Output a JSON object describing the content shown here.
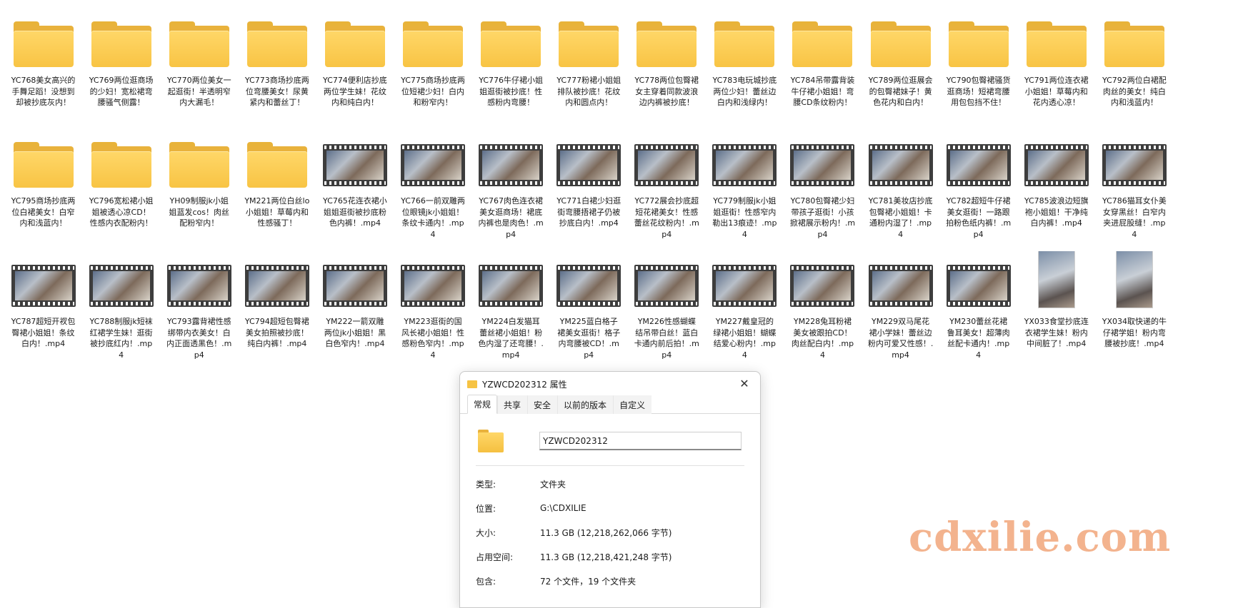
{
  "items": [
    {
      "kind": "folder",
      "label": "YC768美女高兴的手舞足蹈！没想到却被抄底灰内！"
    },
    {
      "kind": "folder",
      "label": "YC769两位逛商场的少妇！宽松裙弯腰骚气侧露！"
    },
    {
      "kind": "folder",
      "label": "YC770两位美女一起逛街！半透明窄内大漏毛！"
    },
    {
      "kind": "folder",
      "label": "YC773商场抄底两位弯腰美女！尿黄紧内和蕾丝丁！"
    },
    {
      "kind": "folder",
      "label": "YC774便利店抄底两位学生妹！花纹内和纯白内！"
    },
    {
      "kind": "folder",
      "label": "YC775商场抄底两位短裙少妇！白内和粉窄内！"
    },
    {
      "kind": "folder",
      "label": "YC776牛仔裙小姐姐逛街被抄底！性感粉内弯腰！"
    },
    {
      "kind": "folder",
      "label": "YC777粉裙小姐姐排队被抄底！花纹内和圆点内！"
    },
    {
      "kind": "folder",
      "label": "YC778两位包臀裙女主穿着同款波浪边内裤被抄底！"
    },
    {
      "kind": "folder",
      "label": "YC783电玩城抄底两位少妇！蕾丝边白内和浅绿内！"
    },
    {
      "kind": "folder",
      "label": "YC784吊带露背装牛仔裙小姐姐！弯腰CD条纹粉内！"
    },
    {
      "kind": "folder",
      "label": "YC789两位逛展会的包臀裙妹子！黄色花内和白内！"
    },
    {
      "kind": "folder",
      "label": "YC790包臀裙骚货逛商场！短裙弯腰用包包挡不住！"
    },
    {
      "kind": "folder",
      "label": "YC791两位连衣裙小姐姐！草莓内和花内透心凉！"
    },
    {
      "kind": "folder",
      "label": "YC792两位白裙配肉丝的美女！纯白内和浅蓝内！"
    },
    {
      "kind": "folder",
      "label": "YC795商场抄底两位白裙美女！白窄内和浅蓝内！"
    },
    {
      "kind": "folder",
      "label": "YC796宽松裙小姐姐被透心凉CD！性感内衣配粉内！"
    },
    {
      "kind": "folder",
      "label": "YH09制服jk小姐姐蓝发cos！肉丝配粉窄内！"
    },
    {
      "kind": "folder",
      "label": "YM221两位白丝lo小姐姐！草莓内和性感骚丁！"
    },
    {
      "kind": "video",
      "label": "YC765花连衣裙小姐姐逛街被抄底粉色内裤！.mp4"
    },
    {
      "kind": "video",
      "label": "YC766一前双雕两位眼镜jk小姐姐！条纹卡通内！.mp4"
    },
    {
      "kind": "video",
      "label": "YC767肉色连衣裙美女逛商场！裙底内裤也是肉色！.mp4"
    },
    {
      "kind": "video",
      "label": "YC771白裙少妇逛街弯腰捂裙子仍被抄底白内！.mp4"
    },
    {
      "kind": "video",
      "label": "YC772展会抄底超短花裙美女！性感蕾丝花纹粉内！.mp4"
    },
    {
      "kind": "video",
      "label": "YC779制服jk小姐姐逛街！性感窄内勒出13痕迹！.mp4"
    },
    {
      "kind": "video",
      "label": "YC780包臀裙少妇带孩子逛街！小孩掀裙展示粉内！.mp4"
    },
    {
      "kind": "video",
      "label": "YC781美妆店抄底包臀裙小姐姐！卡通粉内湿了！.mp4"
    },
    {
      "kind": "video",
      "label": "YC782超短牛仔裙美女逛街！一路跟拍粉色纸内裤！.mp4"
    },
    {
      "kind": "video",
      "label": "YC785波浪边短旗袍小姐姐！干净纯白内裤！.mp4"
    },
    {
      "kind": "video",
      "label": "YC786猫耳女仆美女穿黑丝！白窄内夹进屁股缝！.mp4"
    },
    {
      "kind": "video",
      "label": "YC787超短开衩包臀裙小姐姐！条纹白内！.mp4"
    },
    {
      "kind": "video",
      "label": "YC788制服jk短袜红裙学生妹！逛街被抄底红内！.mp4"
    },
    {
      "kind": "video",
      "label": "YC793露背裙性感绑带内衣美女！白内正面透黑色！.mp4"
    },
    {
      "kind": "video",
      "label": "YC794超短包臀裙美女拍照被抄底！纯白内裤！.mp4"
    },
    {
      "kind": "video",
      "label": "YM222一箭双雕两位jk小姐姐！黑白色窄内！.mp4"
    },
    {
      "kind": "video",
      "label": "YM223逛街的国风长裙小姐姐！性感粉色窄内！.mp4"
    },
    {
      "kind": "video",
      "label": "YM224白发猫耳蕾丝裙小姐姐！粉色内湿了还弯腰！.mp4"
    },
    {
      "kind": "video",
      "label": "YM225蓝白格子裙美女逛街！格子内弯腰被CD！.mp4"
    },
    {
      "kind": "video",
      "label": "YM226性感蝴蝶结吊带白丝！蓝白卡通内前后拍！.mp4"
    },
    {
      "kind": "video",
      "label": "YM227戴皇冠的绿裙小姐姐！蝴蝶结爱心粉内！.mp4"
    },
    {
      "kind": "video",
      "label": "YM228兔耳粉裙美女被跟拍CD！肉丝配白内！.mp4"
    },
    {
      "kind": "video",
      "label": "YM229双马尾花裙小学妹！蕾丝边粉内可爱又性感！.mp4"
    },
    {
      "kind": "video",
      "label": "YM230蕾丝花裙鲁耳美女！超薄肉丝配卡通内！.mp4"
    },
    {
      "kind": "portrait",
      "label": "YX033食堂抄底连衣裙学生妹！粉内中间脏了！.mp4"
    },
    {
      "kind": "portrait",
      "label": "YX034取快递的牛仔裙学姐！粉内弯腰被抄底！.mp4"
    }
  ],
  "dialog": {
    "title": "YZWCD202312 属性",
    "close": "✕",
    "tabs": [
      "常规",
      "共享",
      "安全",
      "以前的版本",
      "自定义"
    ],
    "name_value": "YZWCD202312",
    "props": [
      {
        "k": "类型:",
        "v": "文件夹"
      },
      {
        "k": "位置:",
        "v": "G:\\CDXILIE"
      },
      {
        "k": "大小:",
        "v": "11.3 GB (12,218,262,066 字节)"
      },
      {
        "k": "占用空间:",
        "v": "11.3 GB (12,218,421,248 字节)"
      },
      {
        "k": "包含:",
        "v": "72 个文件，19 个文件夹"
      }
    ]
  },
  "watermark": "cdxilie.com",
  "icons": {
    "folder": "folder-icon",
    "video": "video-thumbnail-icon",
    "close": "close-icon"
  }
}
